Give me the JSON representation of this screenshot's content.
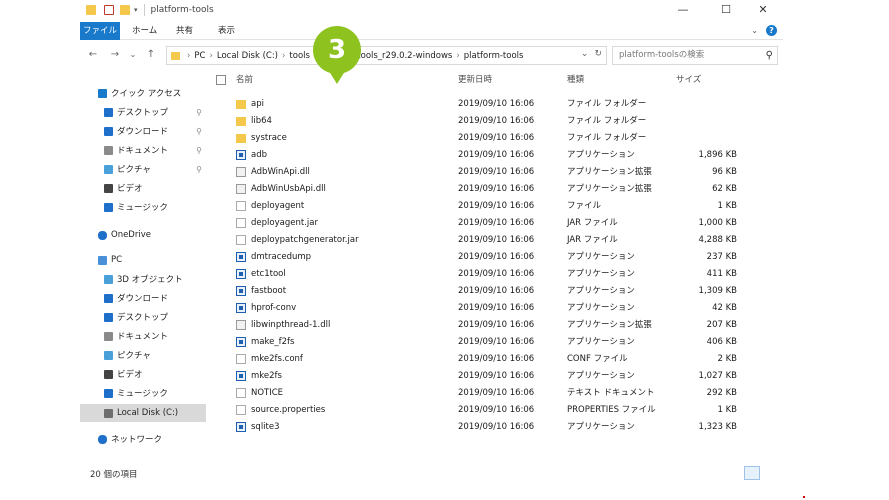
{
  "window": {
    "title": "platform-tools",
    "controls": {
      "minimize": "—",
      "maximize": "☐",
      "close": "✕"
    }
  },
  "ribbon": {
    "tabs": [
      "ファイル",
      "ホーム",
      "共有",
      "表示"
    ],
    "help": "?"
  },
  "nav": {
    "back": "←",
    "forward": "→",
    "recent": "⌄",
    "up": "↑",
    "breadcrumb": [
      "PC",
      "Local Disk (C:)",
      "tools",
      "m-tools_r29.0.2-windows",
      "platform-tools"
    ],
    "refresh": "↻",
    "search_placeholder": "platform-toolsの検索"
  },
  "badge": "3",
  "sidebar": {
    "items": [
      {
        "label": "クイック アクセス",
        "icon": "star-icon",
        "color": "#1979ca",
        "indent": 0
      },
      {
        "label": "デスクトップ",
        "icon": "desktop-icon",
        "color": "#1e6fc9",
        "indent": 1,
        "pinned": true
      },
      {
        "label": "ダウンロード",
        "icon": "download-icon",
        "color": "#1e6fc9",
        "indent": 1,
        "pinned": true
      },
      {
        "label": "ドキュメント",
        "icon": "documents-icon",
        "color": "#8a8a8a",
        "indent": 1,
        "pinned": true
      },
      {
        "label": "ピクチャ",
        "icon": "pictures-icon",
        "color": "#4aa0d8",
        "indent": 1,
        "pinned": true
      },
      {
        "label": "ビデオ",
        "icon": "videos-icon",
        "color": "#444444",
        "indent": 1
      },
      {
        "label": "ミュージック",
        "icon": "music-icon",
        "color": "#1e6fc9",
        "indent": 1
      },
      {
        "label": "OneDrive",
        "icon": "onedrive-icon",
        "color": "#1e6fc9",
        "indent": 0
      },
      {
        "label": "PC",
        "icon": "pc-icon",
        "color": "#4a90d9",
        "indent": 0
      },
      {
        "label": "3D オブジェクト",
        "icon": "3d-objects-icon",
        "color": "#4aa0d8",
        "indent": 1
      },
      {
        "label": "ダウンロード",
        "icon": "download-icon",
        "color": "#1e6fc9",
        "indent": 1
      },
      {
        "label": "デスクトップ",
        "icon": "desktop-icon",
        "color": "#1e6fc9",
        "indent": 1
      },
      {
        "label": "ドキュメント",
        "icon": "documents-icon",
        "color": "#8a8a8a",
        "indent": 1
      },
      {
        "label": "ピクチャ",
        "icon": "pictures-icon",
        "color": "#4aa0d8",
        "indent": 1
      },
      {
        "label": "ビデオ",
        "icon": "videos-icon",
        "color": "#444444",
        "indent": 1
      },
      {
        "label": "ミュージック",
        "icon": "music-icon",
        "color": "#1e6fc9",
        "indent": 1
      },
      {
        "label": "Local Disk (C:)",
        "icon": "drive-icon",
        "color": "#6d6d6d",
        "indent": 1,
        "selected": true
      },
      {
        "label": "ネットワーク",
        "icon": "network-icon",
        "color": "#1e6fc9",
        "indent": 0
      }
    ]
  },
  "columns": {
    "name": "名前",
    "date": "更新日時",
    "type": "種類",
    "size": "サイズ"
  },
  "files": [
    {
      "name": "api",
      "date": "2019/09/10 16:06",
      "type": "ファイル フォルダー",
      "size": "",
      "kind": "folder"
    },
    {
      "name": "lib64",
      "date": "2019/09/10 16:06",
      "type": "ファイル フォルダー",
      "size": "",
      "kind": "folder"
    },
    {
      "name": "systrace",
      "date": "2019/09/10 16:06",
      "type": "ファイル フォルダー",
      "size": "",
      "kind": "folder"
    },
    {
      "name": "adb",
      "date": "2019/09/10 16:06",
      "type": "アプリケーション",
      "size": "1,896 KB",
      "kind": "app"
    },
    {
      "name": "AdbWinApi.dll",
      "date": "2019/09/10 16:06",
      "type": "アプリケーション拡張",
      "size": "96 KB",
      "kind": "dll"
    },
    {
      "name": "AdbWinUsbApi.dll",
      "date": "2019/09/10 16:06",
      "type": "アプリケーション拡張",
      "size": "62 KB",
      "kind": "dll"
    },
    {
      "name": "deployagent",
      "date": "2019/09/10 16:06",
      "type": "ファイル",
      "size": "1 KB",
      "kind": "file"
    },
    {
      "name": "deployagent.jar",
      "date": "2019/09/10 16:06",
      "type": "JAR ファイル",
      "size": "1,000 KB",
      "kind": "file"
    },
    {
      "name": "deploypatchgenerator.jar",
      "date": "2019/09/10 16:06",
      "type": "JAR ファイル",
      "size": "4,288 KB",
      "kind": "file"
    },
    {
      "name": "dmtracedump",
      "date": "2019/09/10 16:06",
      "type": "アプリケーション",
      "size": "237 KB",
      "kind": "app"
    },
    {
      "name": "etc1tool",
      "date": "2019/09/10 16:06",
      "type": "アプリケーション",
      "size": "411 KB",
      "kind": "app"
    },
    {
      "name": "fastboot",
      "date": "2019/09/10 16:06",
      "type": "アプリケーション",
      "size": "1,309 KB",
      "kind": "app"
    },
    {
      "name": "hprof-conv",
      "date": "2019/09/10 16:06",
      "type": "アプリケーション",
      "size": "42 KB",
      "kind": "app"
    },
    {
      "name": "libwinpthread-1.dll",
      "date": "2019/09/10 16:06",
      "type": "アプリケーション拡張",
      "size": "207 KB",
      "kind": "dll"
    },
    {
      "name": "make_f2fs",
      "date": "2019/09/10 16:06",
      "type": "アプリケーション",
      "size": "406 KB",
      "kind": "app"
    },
    {
      "name": "mke2fs.conf",
      "date": "2019/09/10 16:06",
      "type": "CONF ファイル",
      "size": "2 KB",
      "kind": "file"
    },
    {
      "name": "mke2fs",
      "date": "2019/09/10 16:06",
      "type": "アプリケーション",
      "size": "1,027 KB",
      "kind": "app"
    },
    {
      "name": "NOTICE",
      "date": "2019/09/10 16:06",
      "type": "テキスト ドキュメント",
      "size": "292 KB",
      "kind": "file"
    },
    {
      "name": "source.properties",
      "date": "2019/09/10 16:06",
      "type": "PROPERTIES ファイル",
      "size": "1 KB",
      "kind": "file"
    },
    {
      "name": "sqlite3",
      "date": "2019/09/10 16:06",
      "type": "アプリケーション",
      "size": "1,323 KB",
      "kind": "app"
    }
  ],
  "status": {
    "count": "20 個の項目"
  }
}
